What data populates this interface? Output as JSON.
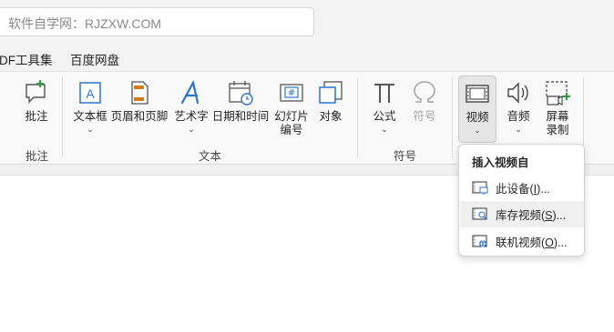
{
  "search": {
    "text": "软件自学网：RJZXW.COM"
  },
  "tabs": [
    {
      "label": "DF工具集"
    },
    {
      "label": "百度网盘"
    }
  ],
  "ribbon": {
    "comment_group": {
      "button": "批注",
      "label": "批注"
    },
    "text_group": {
      "label": "文本",
      "buttons": [
        {
          "label": "文本框"
        },
        {
          "label": "页眉和页脚"
        },
        {
          "label": "艺术字"
        },
        {
          "label": "日期和时间"
        },
        {
          "label": "幻灯片",
          "label2": "编号"
        },
        {
          "label": "对象"
        }
      ]
    },
    "symbol_group": {
      "label": "符号",
      "buttons": [
        {
          "label": "公式"
        },
        {
          "label": "符号"
        }
      ]
    },
    "media_group": {
      "buttons": [
        {
          "label": "视频"
        },
        {
          "label": "音频"
        },
        {
          "label": "屏幕",
          "label2": "录制"
        }
      ]
    }
  },
  "dropdown": {
    "header": "插入视频自",
    "items": [
      {
        "prefix": "此设备(",
        "key": "I",
        "suffix": ")..."
      },
      {
        "prefix": "库存视频(",
        "key": "S",
        "suffix": ")..."
      },
      {
        "prefix": "联机视频(",
        "key": "O",
        "suffix": ")..."
      }
    ]
  },
  "colors": {
    "accent_blue": "#2e74c9",
    "green": "#2e9b3e",
    "orange": "#d67a12"
  }
}
